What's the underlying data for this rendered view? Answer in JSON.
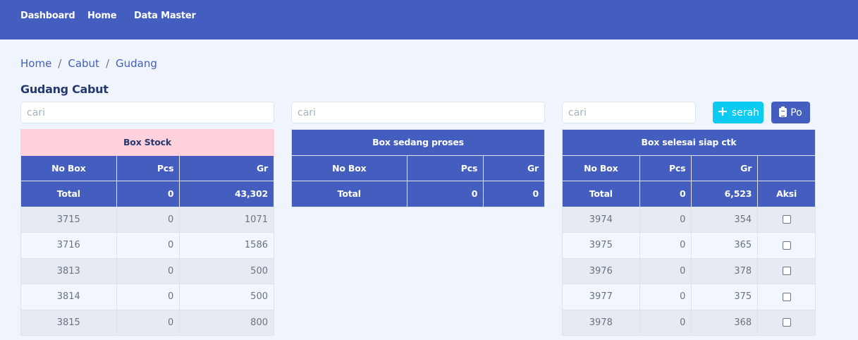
{
  "nav": {
    "items": [
      "Dashboard",
      "Home",
      "Data Master"
    ]
  },
  "breadcrumb": [
    "Home",
    "Cabut",
    "Gudang"
  ],
  "page_title": "Gudang Cabut",
  "search_placeholder": "cari",
  "buttons": {
    "serah": "serah",
    "po": "Po"
  },
  "columns": {
    "no_box": "No Box",
    "pcs": "Pcs",
    "gr": "Gr",
    "aksi": "Aksi"
  },
  "stock": {
    "title": "Box Stock",
    "total": {
      "label": "Total",
      "pcs": "0",
      "gr": "43,302"
    },
    "rows": [
      {
        "no_box": "3715",
        "pcs": "0",
        "gr": "1071"
      },
      {
        "no_box": "3716",
        "pcs": "0",
        "gr": "1586"
      },
      {
        "no_box": "3813",
        "pcs": "0",
        "gr": "500"
      },
      {
        "no_box": "3814",
        "pcs": "0",
        "gr": "500"
      },
      {
        "no_box": "3815",
        "pcs": "0",
        "gr": "800"
      }
    ]
  },
  "proses": {
    "title": "Box sedang proses",
    "total": {
      "label": "Total",
      "pcs": "0",
      "gr": "0"
    }
  },
  "selesai": {
    "title": "Box selesai siap ctk",
    "total": {
      "label": "Total",
      "pcs": "0",
      "gr": "6,523"
    },
    "rows": [
      {
        "no_box": "3974",
        "pcs": "0",
        "gr": "354"
      },
      {
        "no_box": "3975",
        "pcs": "0",
        "gr": "365"
      },
      {
        "no_box": "3976",
        "pcs": "0",
        "gr": "378"
      },
      {
        "no_box": "3977",
        "pcs": "0",
        "gr": "375"
      },
      {
        "no_box": "3978",
        "pcs": "0",
        "gr": "368"
      }
    ]
  }
}
